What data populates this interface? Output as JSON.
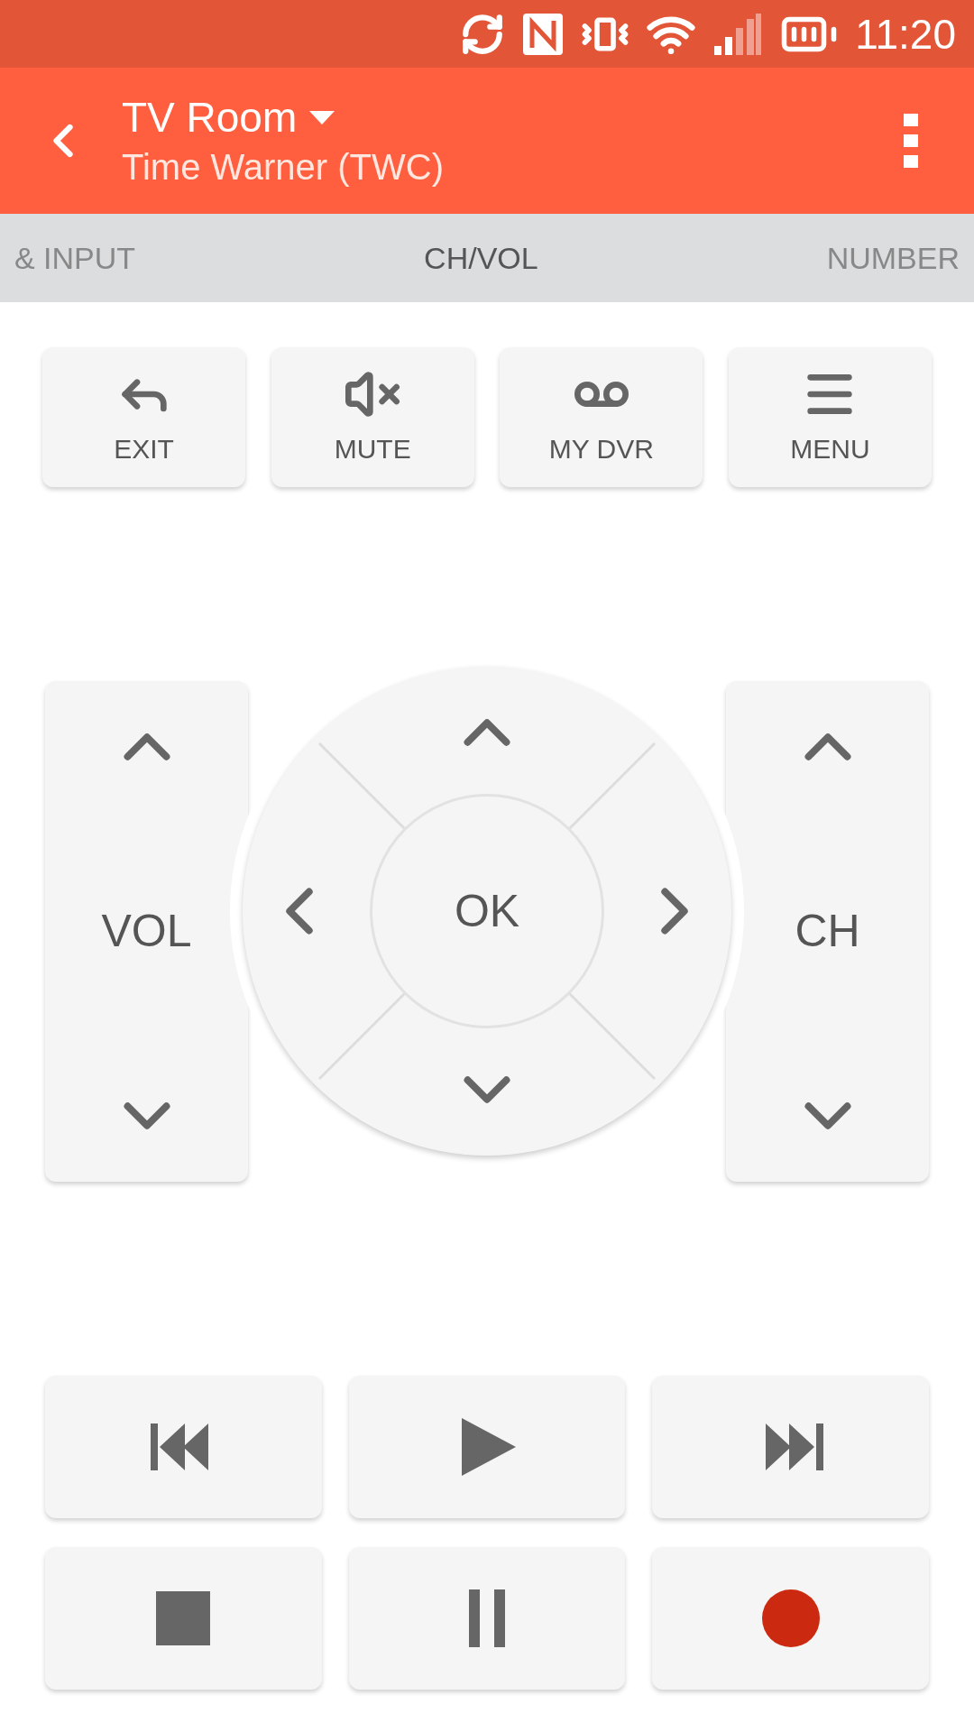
{
  "status_bar": {
    "time": "11:20"
  },
  "header": {
    "title": "TV Room",
    "subtitle": "Time Warner (TWC)"
  },
  "tabs": [
    {
      "label": "& INPUT",
      "selected": false
    },
    {
      "label": "CH/VOL",
      "selected": true
    },
    {
      "label": "NUMBER",
      "selected": false
    }
  ],
  "top_buttons": [
    {
      "kind": "exit",
      "label": "EXIT"
    },
    {
      "kind": "mute",
      "label": "MUTE"
    },
    {
      "kind": "dvr",
      "label": "MY DVR"
    },
    {
      "kind": "menu",
      "label": "MENU"
    }
  ],
  "volume": {
    "label": "VOL"
  },
  "dpad": {
    "center": "OK"
  },
  "channel": {
    "label": "CH"
  },
  "media_buttons": [
    {
      "kind": "previous"
    },
    {
      "kind": "play"
    },
    {
      "kind": "next"
    },
    {
      "kind": "stop"
    },
    {
      "kind": "pause"
    },
    {
      "kind": "record"
    }
  ]
}
